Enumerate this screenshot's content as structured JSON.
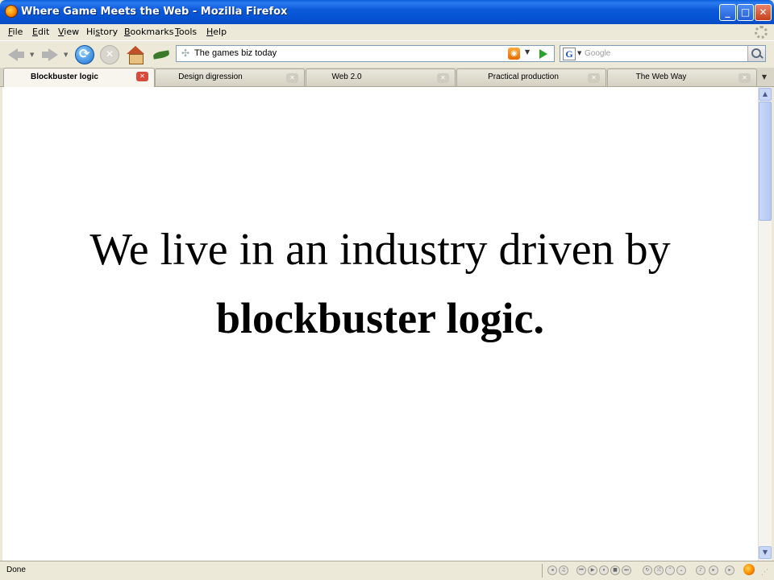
{
  "window": {
    "title": "Where Game Meets the Web - Mozilla Firefox",
    "controls": {
      "minimize": "_",
      "maximize": "□",
      "close": "✕"
    }
  },
  "menu": [
    {
      "key": "F",
      "rest": "ile"
    },
    {
      "key": "E",
      "rest": "dit"
    },
    {
      "key": "V",
      "rest": "iew"
    },
    {
      "pre": "Hi",
      "key": "s",
      "rest": "tory"
    },
    {
      "key": "B",
      "rest": "ookmarks"
    },
    {
      "key": "T",
      "rest": "ools"
    },
    {
      "key": "H",
      "rest": "elp"
    }
  ],
  "navigation": {
    "url": "The games biz today",
    "search_placeholder": "Google",
    "search_engine_letter": "G"
  },
  "tabs": [
    {
      "label": "Blockbuster logic",
      "active": true
    },
    {
      "label": "Design digression",
      "active": false
    },
    {
      "label": "Web 2.0",
      "active": false
    },
    {
      "label": "Practical production",
      "active": false
    },
    {
      "label": "The Web Way",
      "active": false
    }
  ],
  "content": {
    "line1": "We live in an industry driven by",
    "line2": "blockbuster logic."
  },
  "status": {
    "text": "Done"
  },
  "colors": {
    "titlebar": "#0a5fd8",
    "chrome": "#ece9d8",
    "active_tab_close": "#d84a3c"
  }
}
